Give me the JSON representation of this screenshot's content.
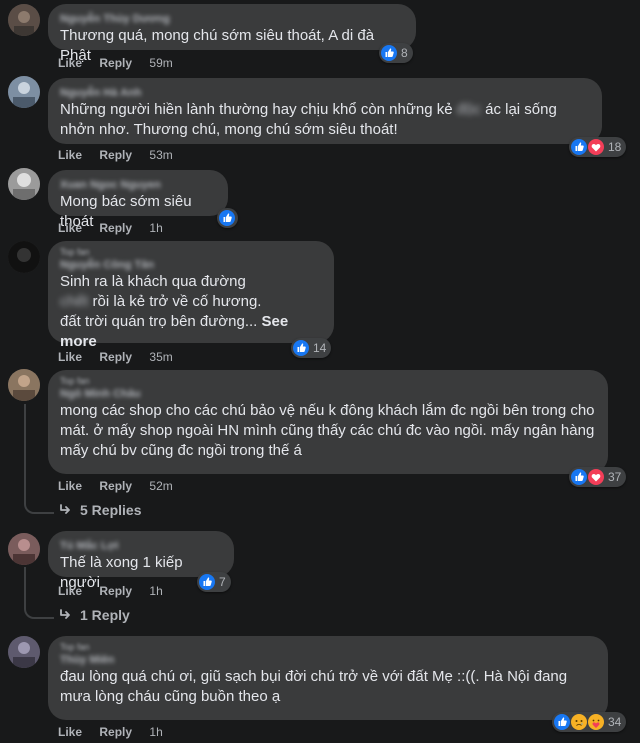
{
  "actions": {
    "like": "Like",
    "reply": "Reply"
  },
  "comments": [
    {
      "name": "Nguyễn Thùy Dương",
      "text": "Thương quá, mong chú sớm siêu thoát, A di đà Phật",
      "time": "59m",
      "reactions": [
        "like"
      ],
      "count": "8"
    },
    {
      "name": "Nguyễn Hà Anh",
      "text1": "Những người hiền lành thường hay chịu khổ còn những kẻ ",
      "text_hidden": "độc",
      "text2": " ác lại sống nhởn nhơ. Thương chú, mong chú sớm siêu thoát!",
      "time": "53m",
      "reactions": [
        "like",
        "love"
      ],
      "count": "18"
    },
    {
      "name": "Xuan Ngoc Nguyen",
      "text": "Mong bác sớm siêu thoát",
      "time": "1h",
      "reactions": [
        "like"
      ],
      "count": ""
    },
    {
      "badge": "Top fan",
      "name": "Nguyễn Công Tân",
      "line1": "Sinh ra là khách qua đường",
      "line2_hidden": "chết",
      "line2": " rồi là kẻ trở về cố hương.",
      "line3": "đất trời quán trọ bên đường...",
      "see_more": "See more",
      "time": "35m",
      "reactions": [
        "like"
      ],
      "count": "14"
    },
    {
      "badge": "Top fan",
      "name": "Ngô Minh Châu",
      "text": "mong các shop cho các chú bảo vệ nếu k đông khách lắm đc ngồi bên trong cho mát. ở mấy shop ngoài HN mình cũng thấy các chú đc vào ngồi. mấy ngân hàng mấy chú bv cũng đc ngồi trong thế á",
      "time": "52m",
      "reactions": [
        "like",
        "love"
      ],
      "count": "37",
      "replies": "5 Replies"
    },
    {
      "name": "Tú Mắc Lợi",
      "text": "Thế là xong 1 kiếp người",
      "time": "1h",
      "reactions": [
        "like"
      ],
      "count": "7",
      "replies": "1 Reply"
    },
    {
      "badge": "Top fan",
      "name": "Thùy Miên",
      "text": "đau lòng quá chú ơi, giũ sạch bụi đời chú trở về với đất Mẹ ::((. Hà Nội đang mưa lòng cháu cũng buồn theo ạ",
      "time": "1h",
      "reactions": [
        "like",
        "sad",
        "care"
      ],
      "count": "34"
    }
  ]
}
